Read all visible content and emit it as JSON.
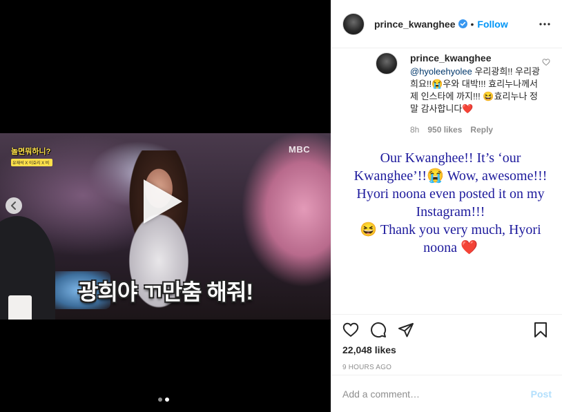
{
  "media": {
    "show_logo_title": "놀면뭐하니?",
    "show_logo_subtitle": "유재석 X 이효리 X 비",
    "channel_logo": "MBC",
    "subtitle_caption": "광희야 ㄲ만춤 해줘!",
    "carousel": {
      "count": 2,
      "active_index": 1
    },
    "icons": {
      "play": "play-icon",
      "previous": "chevron-left-icon"
    }
  },
  "header": {
    "username": "prince_kwanghee",
    "verified": true,
    "separator": "•",
    "follow_label": "Follow",
    "more_icon": "more-horizontal-icon"
  },
  "comment": {
    "username": "prince_kwanghee",
    "mention": "@hyoleehyolee",
    "text_parts": [
      "우리광희!! 우리광희요!!",
      "😭",
      "우와 대박!!! 효리누나께서 제 인스타에 까지!!!",
      "😆",
      "효리누나 정말 감사합니다",
      "❤️"
    ],
    "time": "8h",
    "likes": "950 likes",
    "reply_label": "Reply"
  },
  "translation": {
    "line1": "Our Kwanghee!! It’s ‘our Kwanghee’!!",
    "emoji1": "😭",
    "line2": " Wow, awesome!!! Hyori noona even posted it on my Instagram!!!",
    "emoji2": "😆",
    "line3": " Thank you very much, Hyori noona ",
    "emoji3": "❤️"
  },
  "actions": {
    "icons": [
      "heart-icon",
      "comment-icon",
      "share-icon",
      "bookmark-icon"
    ],
    "likes_count": "22,048 likes",
    "time_ago": "9 HOURS AGO"
  },
  "add_comment": {
    "placeholder": "Add a comment…",
    "post_label": "Post"
  },
  "colors": {
    "link_blue": "#0095f6",
    "post_disabled": "#b2dffc",
    "translation_text": "#1d1a9c",
    "heart_red": "#ed4956"
  }
}
